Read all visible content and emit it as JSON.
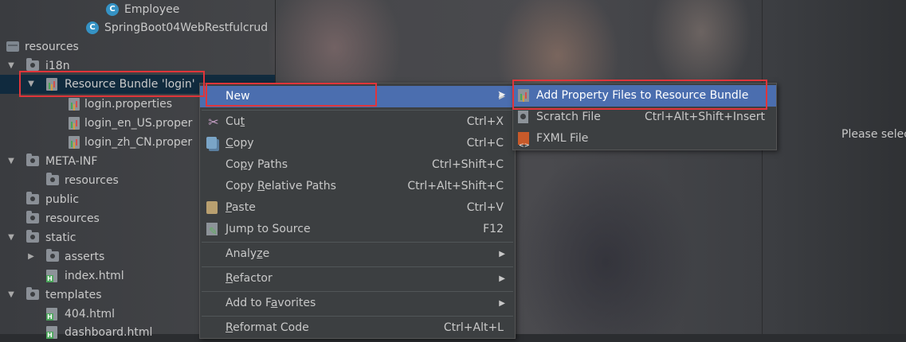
{
  "tree": {
    "rows": [
      {
        "label": "Employee",
        "kind": "class",
        "indent": 1
      },
      {
        "label": "SpringBoot04WebRestfulcrud",
        "kind": "spring",
        "indent": 1
      },
      {
        "label": "resources",
        "kind": "resources-root",
        "expanded": true
      },
      {
        "label": "i18n",
        "kind": "folder",
        "expanded": true
      },
      {
        "label": "Resource Bundle 'login'",
        "kind": "bundle",
        "expanded": true,
        "selected": true
      },
      {
        "label": "login.properties",
        "kind": "properties"
      },
      {
        "label": "login_en_US.proper",
        "kind": "properties"
      },
      {
        "label": "login_zh_CN.proper",
        "kind": "properties"
      },
      {
        "label": "META-INF",
        "kind": "folder",
        "expanded": true
      },
      {
        "label": "resources",
        "kind": "folder"
      },
      {
        "label": "public",
        "kind": "folder"
      },
      {
        "label": "resources",
        "kind": "folder"
      },
      {
        "label": "static",
        "kind": "folder",
        "expanded": true
      },
      {
        "label": "asserts",
        "kind": "folder",
        "expanded": false
      },
      {
        "label": "index.html",
        "kind": "html"
      },
      {
        "label": "templates",
        "kind": "folder",
        "expanded": true
      },
      {
        "label": "404.html",
        "kind": "html"
      },
      {
        "label": "dashboard.html",
        "kind": "html"
      }
    ]
  },
  "context_menu": {
    "items": [
      {
        "label": "New",
        "shortcut": "",
        "submenu": true,
        "active": true
      },
      {
        "label": "Cut",
        "shortcut": "Ctrl+X",
        "icon": "scissors-icon"
      },
      {
        "label": "Copy",
        "shortcut": "Ctrl+C",
        "icon": "copy-icon"
      },
      {
        "label": "Copy Paths",
        "shortcut": "Ctrl+Shift+C"
      },
      {
        "label": "Copy Relative Paths",
        "shortcut": "Ctrl+Alt+Shift+C"
      },
      {
        "label": "Paste",
        "shortcut": "Ctrl+V",
        "icon": "paste-icon"
      },
      {
        "label": "Jump to Source",
        "shortcut": "F12",
        "icon": "jump-to-source-icon"
      },
      {
        "label": "Analyze",
        "shortcut": "",
        "submenu": true
      },
      {
        "label": "Refactor",
        "shortcut": "",
        "submenu": true
      },
      {
        "label": "Add to Favorites",
        "shortcut": "",
        "submenu": true
      },
      {
        "label": "Reformat Code",
        "shortcut": "Ctrl+Alt+L"
      }
    ]
  },
  "submenu": {
    "items": [
      {
        "label": "Add Property Files to Resource Bundle",
        "shortcut": "",
        "active": true,
        "icon": "resource-bundle-icon"
      },
      {
        "label": "Scratch File",
        "shortcut": "Ctrl+Alt+Shift+Insert",
        "icon": "scratch-file-icon"
      },
      {
        "label": "FXML File",
        "shortcut": "",
        "icon": "fxml-file-icon"
      }
    ]
  },
  "editor_hint": "Please selec",
  "colors": {
    "menu_bg": "#3c3f41",
    "menu_active": "#4b6eaf",
    "selection": "#0d293e",
    "highlight_box": "#e0353a"
  }
}
